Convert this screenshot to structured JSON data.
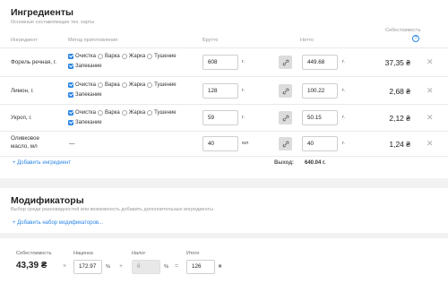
{
  "ingredients": {
    "title": "Ингредиенты",
    "subtitle": "Основные составляющие тех. карты",
    "headers": {
      "ingredient": "Ингредиент",
      "method": "Метод приготовления",
      "gross": "Брутто",
      "net": "Нетто",
      "cost": "Себестоимость",
      "help": "?"
    },
    "method_options": [
      "Очистка",
      "Варка",
      "Жарка",
      "Тушение",
      "Запекание"
    ],
    "rows": [
      {
        "name_line1": "Форель речная, г.",
        "name_line2": "",
        "checked": [
          "Очистка",
          "Запекание"
        ],
        "gross": "608",
        "gross_unit": "г.",
        "net": "449.68",
        "net_unit": "г.",
        "cost": "37,35 ₴"
      },
      {
        "name_line1": "Лимон, г.",
        "name_line2": "",
        "checked": [
          "Очистка",
          "Запекание"
        ],
        "gross": "128",
        "gross_unit": "г.",
        "net": "100.22",
        "net_unit": "г.",
        "cost": "2,68 ₴"
      },
      {
        "name_line1": "Укроп, г.",
        "name_line2": "",
        "checked": [
          "Очистка",
          "Запекание"
        ],
        "gross": "59",
        "gross_unit": "г.",
        "net": "50.15",
        "net_unit": "г.",
        "cost": "2,12 ₴"
      },
      {
        "name_line1": "Оливковое",
        "name_line2": "масло, мл",
        "method_placeholder": "—",
        "gross": "40",
        "gross_unit": "мл",
        "net": "40",
        "net_unit": "г.",
        "cost": "1,24 ₴"
      }
    ],
    "add_label": "+ Добавить ингредиент",
    "yield_label": "Выход:",
    "yield_value": "640.04 г."
  },
  "modifiers": {
    "title": "Модификаторы",
    "subtitle": "Выбор среди разновидностей или возможность добавить дополнительные ингредиенты",
    "add_label": "+ Добавить набор модификаторов..."
  },
  "footer": {
    "cost_label": "Себестоимость",
    "cost_value": "43,39 ₴",
    "markup_label": "Наценка",
    "markup_value": "172.97",
    "markup_unit": "%",
    "tax_label": "Налог",
    "tax_value": "6",
    "tax_unit": "%",
    "total_label": "Итого",
    "total_value": "126",
    "total_unit": "₴",
    "op_times": "×",
    "op_plus": "+",
    "op_equals": "="
  },
  "colors": {
    "accent": "#2b86e6",
    "background": "#f2f2f2",
    "panel": "#ffffff"
  }
}
